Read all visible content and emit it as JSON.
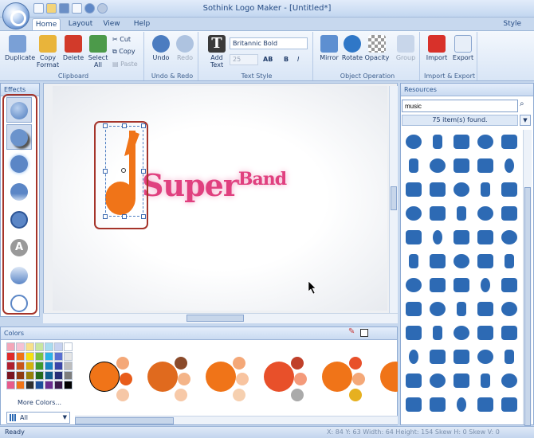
{
  "window": {
    "title": "Sothink Logo Maker - [Untitled*]",
    "style_label": "Style"
  },
  "tabs": [
    {
      "label": "Home"
    },
    {
      "label": "Layout"
    },
    {
      "label": "View"
    },
    {
      "label": "Help"
    }
  ],
  "ribbon": {
    "clipboard": {
      "group_label": "Clipboard",
      "duplicate": "Duplicate",
      "copy_format": "Copy Format",
      "delete": "Delete",
      "select_all": "Select All",
      "cut": "Cut",
      "copy": "Copy",
      "paste": "Paste"
    },
    "undo_redo": {
      "group_label": "Undo & Redo",
      "undo": "Undo",
      "redo": "Redo"
    },
    "text_style": {
      "group_label": "Text Style",
      "add_text": "Add Text",
      "font": "Britannic Bold",
      "size": "25"
    },
    "object_operation": {
      "group_label": "Object Operation",
      "mirror": "Mirror",
      "rotate": "Rotate",
      "opacity": "Opacity",
      "group": "Group"
    },
    "import_export": {
      "group_label": "Import & Export",
      "import": "Import",
      "export": "Export"
    }
  },
  "effects": {
    "title": "Effects"
  },
  "canvas": {
    "logo_text_main": "Super",
    "logo_text_sup": "Band",
    "accent_color": "#e0407f",
    "note_color": "#f07418"
  },
  "resources": {
    "title": "Resources",
    "search_value": "music",
    "found_text": "75 item(s) found."
  },
  "colors": {
    "title": "Colors",
    "more_colors": "More Colors...",
    "filter_value": "All"
  },
  "status": {
    "ready": "Ready",
    "coords": "X: 84   Y: 63   Width: 64   Height: 154   Skew H: 0   Skew V: 0"
  }
}
